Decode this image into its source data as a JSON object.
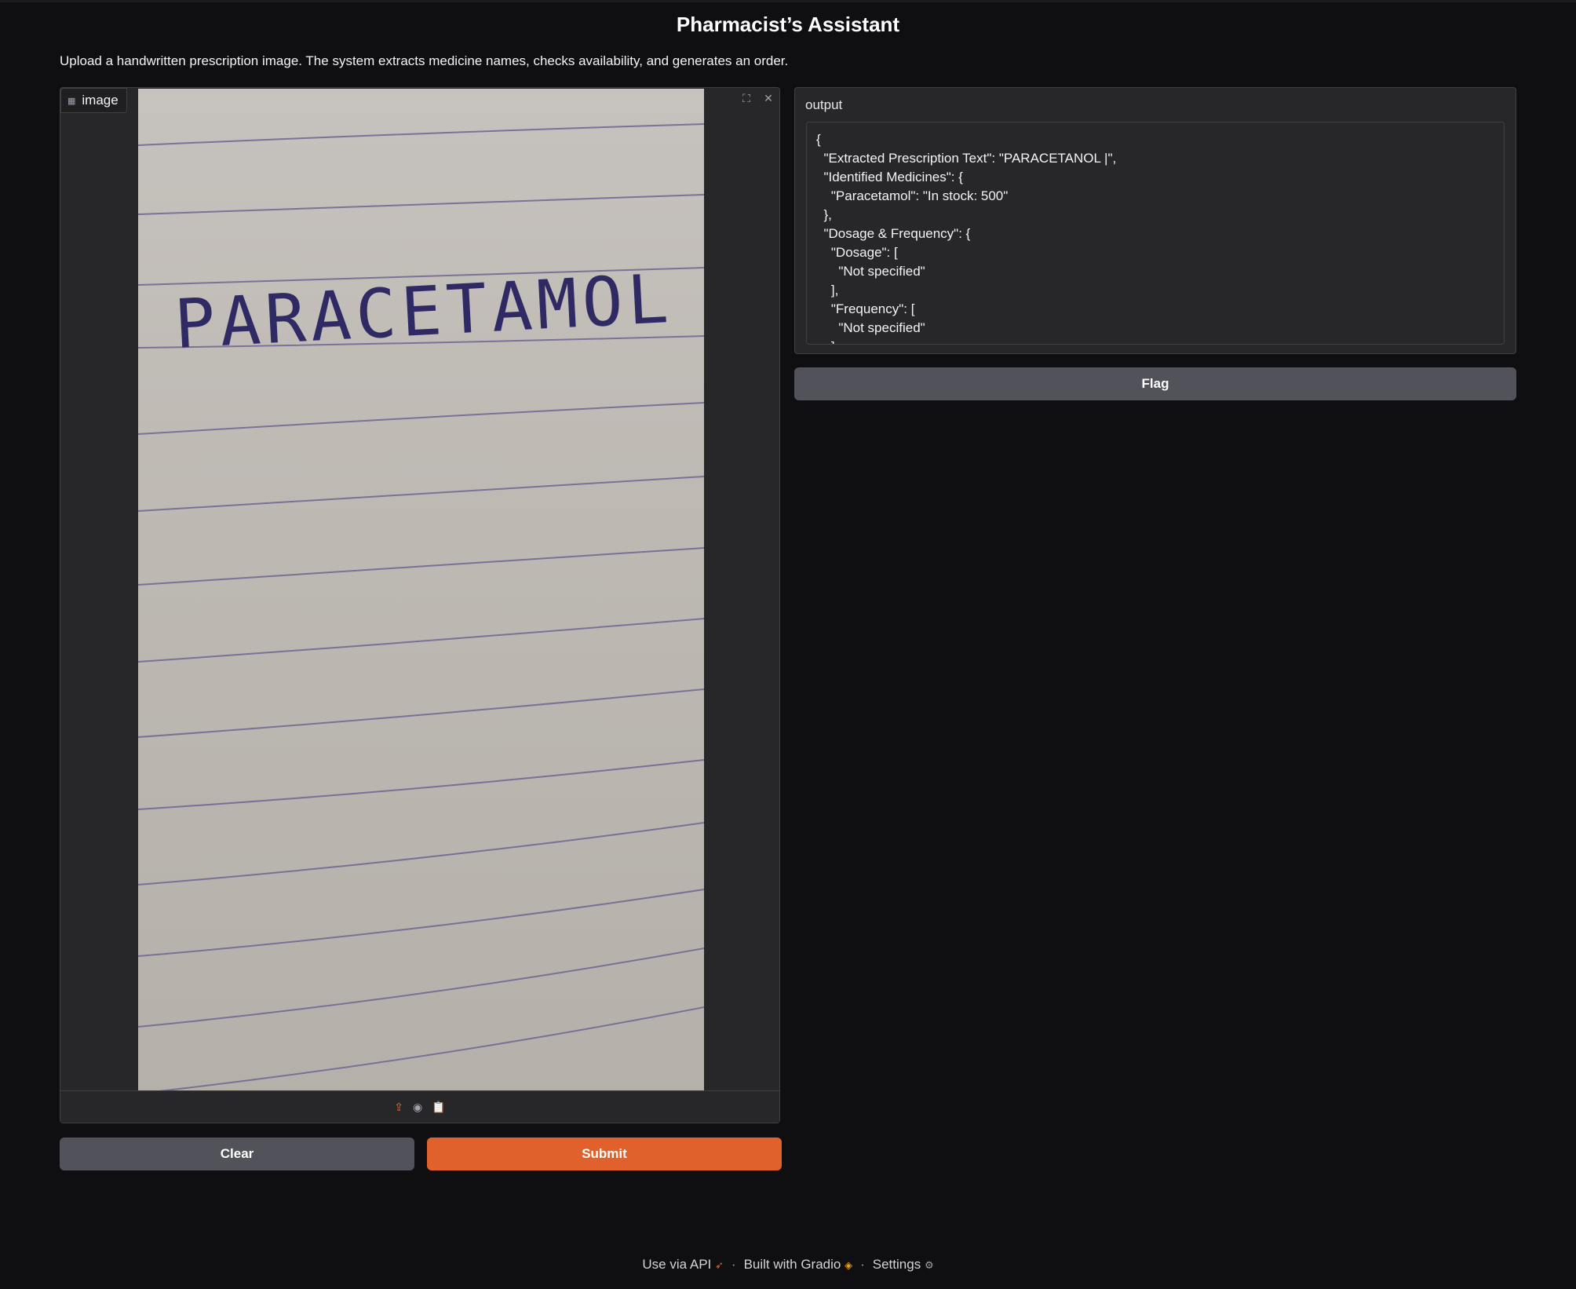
{
  "app": {
    "title": "Pharmacist’s Assistant",
    "description": "Upload a handwritten prescription image. The system extracts medicine names, checks availability, and generates an order."
  },
  "image_input": {
    "label": "image",
    "label_icon": "image-icon",
    "tools": [
      "fullscreen-icon",
      "close-icon"
    ],
    "photo_handwriting": "PARACETAMOL",
    "sources": [
      "upload-icon",
      "webcam-icon",
      "clipboard-icon"
    ]
  },
  "output": {
    "label": "output",
    "text": "{\n  \"Extracted Prescription Text\": \"PARACETANOL |\",\n  \"Identified Medicines\": {\n    \"Paracetamol\": \"In stock: 500\"\n  },\n  \"Dosage & Frequency\": {\n    \"Dosage\": [\n      \"Not specified\"\n    ],\n    \"Frequency\": [\n      \"Not specified\"\n    ]"
  },
  "buttons": {
    "clear": "Clear",
    "submit": "Submit",
    "flag": "Flag"
  },
  "footer": {
    "api": "Use via API",
    "built": "Built with Gradio",
    "settings": "Settings",
    "separator": "·"
  },
  "colors": {
    "background": "#0f0f11",
    "panel": "#27272a",
    "primary": "#e0612b",
    "secondary": "#52525b"
  }
}
